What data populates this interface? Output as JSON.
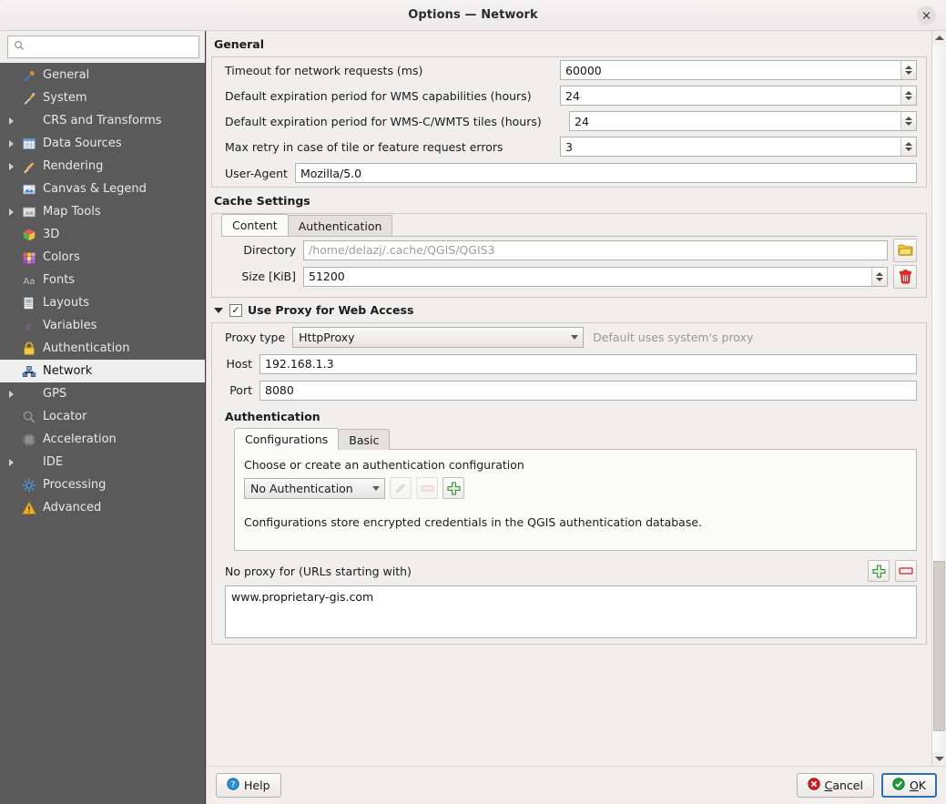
{
  "window": {
    "title": "Options — Network",
    "close_icon": "close-icon"
  },
  "sidebar": {
    "search": {
      "placeholder": "",
      "value": "",
      "icon": "search-icon"
    },
    "items": [
      {
        "label": "General",
        "icon": "hammer-wrench-icon",
        "expandable": false,
        "selected": false,
        "indent": true
      },
      {
        "label": "System",
        "icon": "system-tools-icon",
        "expandable": false,
        "selected": false,
        "indent": true
      },
      {
        "label": "CRS and Transforms",
        "icon": "none",
        "expandable": true,
        "selected": false,
        "indent": false
      },
      {
        "label": "Data Sources",
        "icon": "table-icon",
        "expandable": true,
        "selected": false,
        "indent": false
      },
      {
        "label": "Rendering",
        "icon": "brush-icon",
        "expandable": true,
        "selected": false,
        "indent": false
      },
      {
        "label": "Canvas & Legend",
        "icon": "canvas-icon",
        "expandable": false,
        "selected": false,
        "indent": true
      },
      {
        "label": "Map Tools",
        "icon": "map-tools-icon",
        "expandable": true,
        "selected": false,
        "indent": false
      },
      {
        "label": "3D",
        "icon": "cube-icon",
        "expandable": false,
        "selected": false,
        "indent": true
      },
      {
        "label": "Colors",
        "icon": "color-swatch-icon",
        "expandable": false,
        "selected": false,
        "indent": true
      },
      {
        "label": "Fonts",
        "icon": "font-aa-icon",
        "expandable": false,
        "selected": false,
        "indent": true
      },
      {
        "label": "Layouts",
        "icon": "layout-page-icon",
        "expandable": false,
        "selected": false,
        "indent": true
      },
      {
        "label": "Variables",
        "icon": "epsilon-icon",
        "expandable": false,
        "selected": false,
        "indent": true
      },
      {
        "label": "Authentication",
        "icon": "lock-icon",
        "expandable": false,
        "selected": false,
        "indent": true
      },
      {
        "label": "Network",
        "icon": "network-nodes-icon",
        "expandable": false,
        "selected": true,
        "indent": true
      },
      {
        "label": "GPS",
        "icon": "none",
        "expandable": true,
        "selected": false,
        "indent": false
      },
      {
        "label": "Locator",
        "icon": "magnifier-icon",
        "expandable": false,
        "selected": false,
        "indent": true
      },
      {
        "label": "Acceleration",
        "icon": "chip-icon",
        "expandable": false,
        "selected": false,
        "indent": true
      },
      {
        "label": "IDE",
        "icon": "none",
        "expandable": true,
        "selected": false,
        "indent": false
      },
      {
        "label": "Processing",
        "icon": "gear-icon",
        "expandable": false,
        "selected": false,
        "indent": true
      },
      {
        "label": "Advanced",
        "icon": "warning-icon",
        "expandable": false,
        "selected": false,
        "indent": true
      }
    ]
  },
  "general": {
    "title": "General",
    "fields": [
      {
        "label": "Timeout for network requests (ms)",
        "value": "60000",
        "spinner": true
      },
      {
        "label": "Default expiration period for WMS capabilities (hours)",
        "value": "24",
        "spinner": true
      },
      {
        "label": "Default expiration period for WMS-C/WMTS tiles (hours)",
        "value": "24",
        "spinner": true
      },
      {
        "label": "Max retry in case of tile or feature request errors",
        "value": "3",
        "spinner": true
      }
    ],
    "user_agent": {
      "label": "User-Agent",
      "value": "Mozilla/5.0"
    }
  },
  "cache": {
    "title": "Cache Settings",
    "tabs": [
      {
        "label": "Content",
        "active": true
      },
      {
        "label": "Authentication",
        "active": false
      }
    ],
    "directory": {
      "label": "Directory",
      "value": "",
      "placeholder": "/home/delazj/.cache/QGIS/QGIS3",
      "browse_icon": "folder-icon"
    },
    "size": {
      "label": "Size [KiB]",
      "value": "51200",
      "clear_icon": "trash-icon"
    }
  },
  "proxy": {
    "header_label": "Use Proxy for Web Access",
    "checked": true,
    "expanded": true,
    "type": {
      "label": "Proxy type",
      "value": "HttpProxy",
      "hint": "Default uses system's proxy"
    },
    "host": {
      "label": "Host",
      "value": "192.168.1.3"
    },
    "port": {
      "label": "Port",
      "value": "8080"
    }
  },
  "auth": {
    "title": "Authentication",
    "tabs": [
      {
        "label": "Configurations",
        "active": true
      },
      {
        "label": "Basic",
        "active": false
      }
    ],
    "prompt": "Choose or create an authentication configuration",
    "config_value": "No Authentication",
    "buttons": [
      {
        "name": "edit-config-button",
        "icon": "pencil-icon",
        "disabled": true
      },
      {
        "name": "remove-config-button",
        "icon": "minus-icon",
        "disabled": true
      },
      {
        "name": "add-config-button",
        "icon": "plus-icon",
        "disabled": false
      }
    ],
    "note": "Configurations store encrypted credentials in the QGIS authentication database."
  },
  "noproxy": {
    "label": "No proxy for (URLs starting with)",
    "add_icon": "plus-icon",
    "remove_icon": "minus-icon",
    "entries": [
      "www.proprietary-gis.com"
    ]
  },
  "footer": {
    "help": "Help",
    "help_icon": "help-icon",
    "cancel": "Cancel",
    "cancel_icon": "cancel-icon",
    "ok": "OK",
    "ok_icon": "ok-icon"
  },
  "colors": {
    "sidebar_bg": "#5a5a5a",
    "selected_row": "#efefef",
    "accent_focus": "#2f6fb5",
    "ok_green": "#1f9d3a",
    "cancel_red": "#cc2026"
  }
}
